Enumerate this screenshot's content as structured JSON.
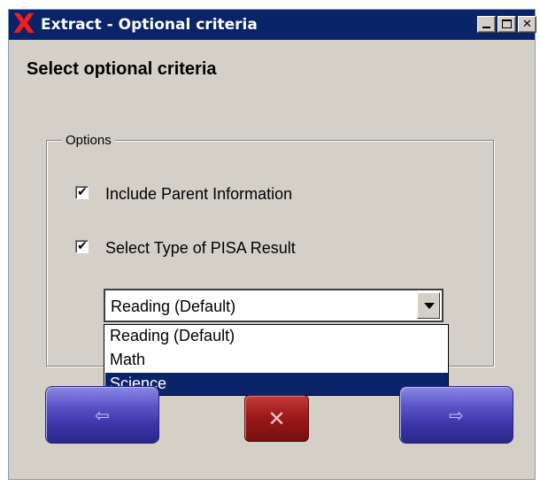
{
  "window": {
    "title": "Extract - Optional criteria",
    "app_icon_glyph": "X",
    "title_bar_color": "#0a246a",
    "controls": [
      "minimize-icon",
      "maximize-icon",
      "close-icon"
    ],
    "close_glyph": "✕"
  },
  "page": {
    "heading": "Select optional criteria"
  },
  "options_group": {
    "legend": "Options",
    "checkboxes": [
      {
        "label": "Include Parent Information",
        "checked": true
      },
      {
        "label": "Select Type of PISA Result",
        "checked": true
      }
    ],
    "check_glyph": "✔"
  },
  "result_type_select": {
    "value": "Reading (Default)",
    "options": [
      "Reading (Default)",
      "Math",
      "Science"
    ],
    "highlighted": "Science"
  },
  "nav_buttons": {
    "back": {
      "icon": "arrow-left-icon",
      "glyph": "⇦"
    },
    "cancel": {
      "icon": "x-icon",
      "glyph": "✕"
    },
    "next": {
      "icon": "arrow-right-icon",
      "glyph": "⇨"
    }
  },
  "colors": {
    "nav_purple": "#3a33a6",
    "cancel_red": "#9d1a1a",
    "selection": "#0a246a"
  }
}
